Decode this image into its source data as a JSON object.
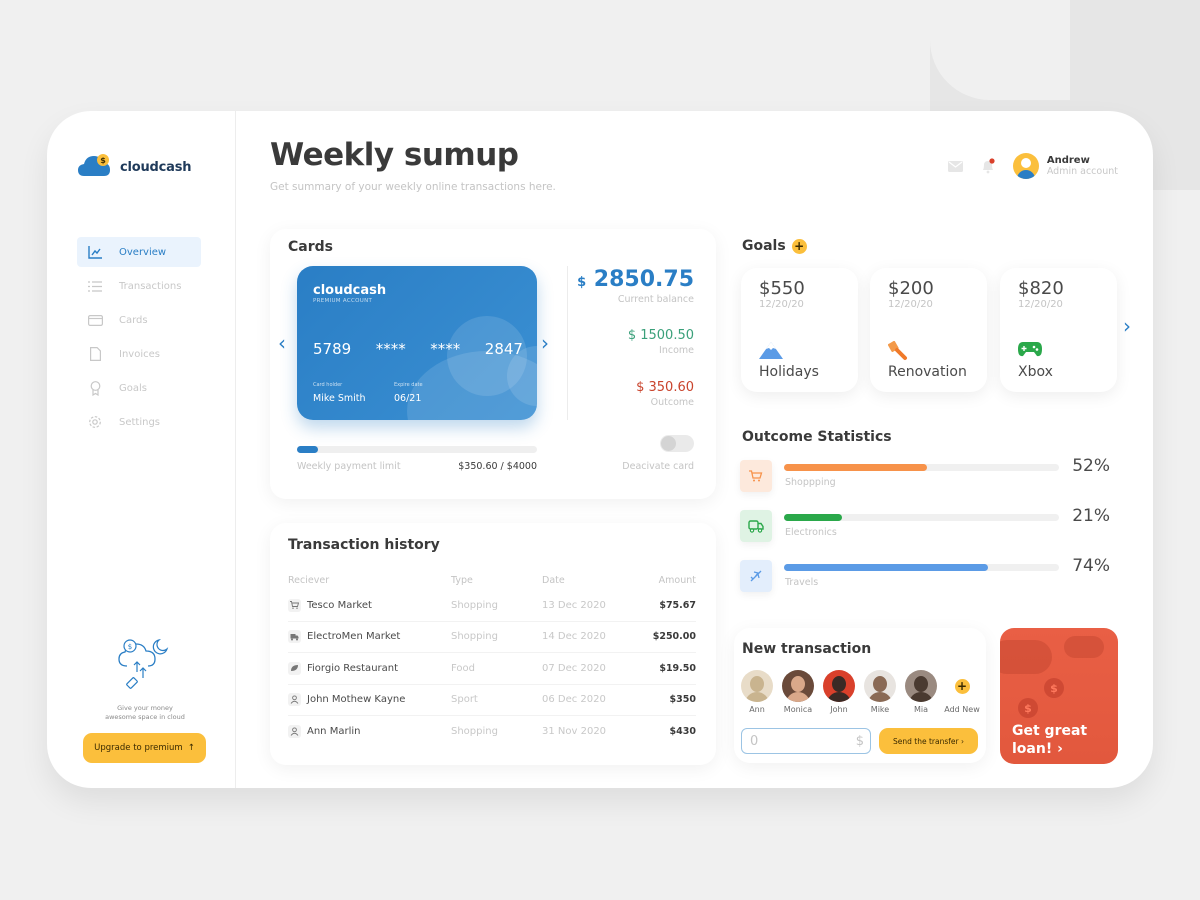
{
  "app": {
    "brand": "cloudcash"
  },
  "sidebar": {
    "items": [
      {
        "label": "Overview",
        "icon": "chart-line-icon",
        "active": true
      },
      {
        "label": "Transactions",
        "icon": "list-icon"
      },
      {
        "label": "Cards",
        "icon": "credit-card-icon"
      },
      {
        "label": "Invoices",
        "icon": "document-icon"
      },
      {
        "label": "Goals",
        "icon": "award-icon"
      },
      {
        "label": "Settings",
        "icon": "gear-icon"
      }
    ],
    "promo_text_line1": "Give your money",
    "promo_text_line2": "awesome space in cloud",
    "upgrade_label": "Upgrade to premium"
  },
  "header": {
    "title": "Weekly sumup",
    "subtitle": "Get summary of your weekly online transactions here.",
    "user_name": "Andrew",
    "user_role": "Admin account"
  },
  "cards": {
    "title": "Cards",
    "card": {
      "brand": "cloudcash",
      "tier": "PREMIUM ACCOUNT",
      "number_parts": [
        "5789",
        "****",
        "****",
        "2847"
      ],
      "holder_label": "Card holder",
      "holder": "Mike Smith",
      "expiry_label": "Expire date",
      "expiry": "06/21"
    },
    "balance_currency": "$",
    "balance": "2850.75",
    "balance_label": "Current balance",
    "income": "$ 1500.50",
    "income_label": "Income",
    "outcome": "$ 350.60",
    "outcome_label": "Outcome",
    "limit_label": "Weekly payment limit",
    "limit_value": "$350.60 / $4000",
    "limit_fraction": 0.0877,
    "deactivate_label": "Deacivate card",
    "deactivated": false
  },
  "history": {
    "title": "Transaction history",
    "columns": [
      "Reciever",
      "Type",
      "Date",
      "Amount"
    ],
    "rows": [
      {
        "receiver": "Tesco Market",
        "icon": "cart-icon",
        "type": "Shopping",
        "date": "13 Dec 2020",
        "amount": "$75.67"
      },
      {
        "receiver": "ElectroMen Market",
        "icon": "truck-icon",
        "type": "Shopping",
        "date": "14 Dec 2020",
        "amount": "$250.00"
      },
      {
        "receiver": "Fiorgio Restaurant",
        "icon": "leaf-icon",
        "type": "Food",
        "date": "07 Dec 2020",
        "amount": "$19.50"
      },
      {
        "receiver": "John Mothew Kayne",
        "icon": "person-icon",
        "type": "Sport",
        "date": "06 Dec 2020",
        "amount": "$350"
      },
      {
        "receiver": "Ann Marlin",
        "icon": "person-icon",
        "type": "Shopping",
        "date": "31 Nov 2020",
        "amount": "$430"
      }
    ]
  },
  "goals": {
    "title": "Goals",
    "items": [
      {
        "value": "$550",
        "date": "12/20/20",
        "name": "Holidays",
        "icon": "mountain-icon"
      },
      {
        "value": "$200",
        "date": "12/20/20",
        "name": "Renovation",
        "icon": "paint-brush-icon"
      },
      {
        "value": "$820",
        "date": "12/20/20",
        "name": "Xbox",
        "icon": "gamepad-icon"
      }
    ]
  },
  "stats": {
    "title": "Outcome Statistics",
    "items": [
      {
        "label": "Shoppping",
        "percent": "52%",
        "value": 52,
        "color": "#f7924a",
        "bg": "#fde9dc",
        "icon": "cart-icon"
      },
      {
        "label": "Electronics",
        "percent": "21%",
        "value": 21,
        "color": "#2aa84a",
        "bg": "#dff3e4",
        "icon": "truck-icon"
      },
      {
        "label": "Travels",
        "percent": "74%",
        "value": 74,
        "color": "#5b9be6",
        "bg": "#e3eefc",
        "icon": "airplane-icon"
      }
    ]
  },
  "new_transaction": {
    "title": "New transaction",
    "people": [
      "Ann",
      "Monica",
      "John",
      "Mike",
      "Mia"
    ],
    "add_label": "Add New",
    "amount_value": "0",
    "currency": "$",
    "send_label": "Send the transfer"
  },
  "loan": {
    "line1": "Get great",
    "line2": "loan!"
  }
}
